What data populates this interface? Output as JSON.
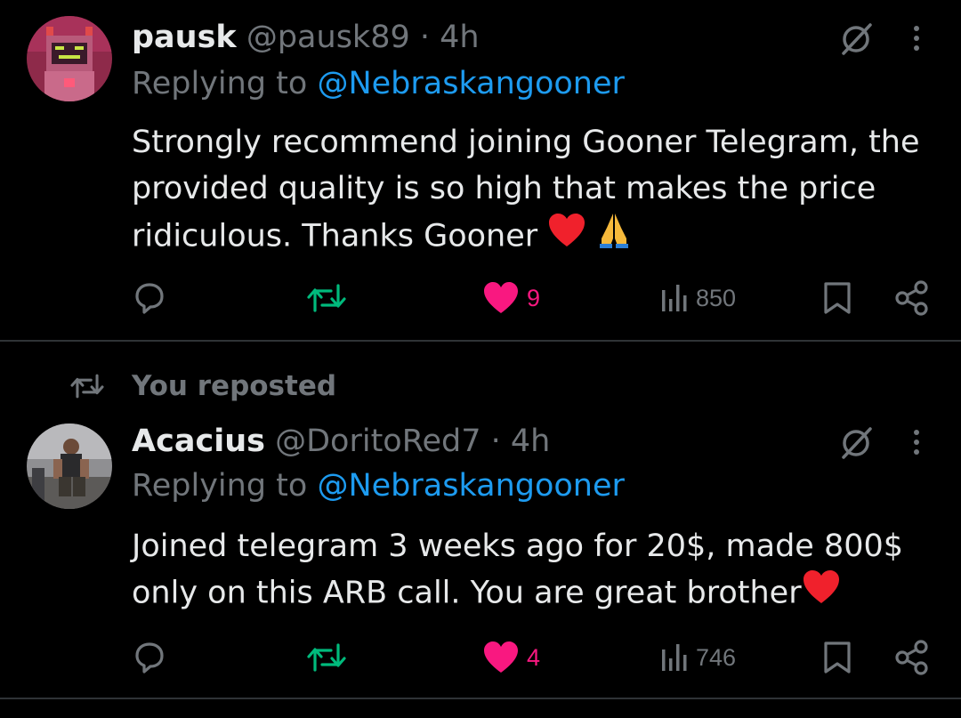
{
  "tweets": [
    {
      "display_name": "pausk",
      "handle": "@pausk89",
      "separator": "·",
      "time": "4h",
      "replying_prefix": "Replying to",
      "replying_to": "@Nebraskangooner",
      "text": "Strongly recommend joining Gooner Telegram, the provided quality is so high that makes the price ridiculous. Thanks Gooner",
      "emojis": [
        "red-heart",
        "folded-hands"
      ],
      "likes": "9",
      "views": "850",
      "liked": true
    },
    {
      "repost_label": "You reposted",
      "display_name": "Acacius",
      "handle": "@DoritoRed7",
      "separator": "·",
      "time": "4h",
      "replying_prefix": "Replying to",
      "replying_to": "@Nebraskangooner",
      "text": "Joined telegram 3 weeks ago for 20$, made 800$ only on this ARB call. You are great brother",
      "emojis": [
        "red-heart"
      ],
      "likes": "4",
      "views": "746",
      "liked": true
    }
  ],
  "colors": {
    "background": "#000000",
    "text": "#e7e9ea",
    "muted": "#71767b",
    "mention": "#1d9bf0",
    "repost": "#00ba7c",
    "like": "#f91880",
    "divider": "#2f3336"
  },
  "icons": {
    "reply": "reply-bubble-icon",
    "repost": "repost-arrows-icon",
    "like": "heart-icon",
    "views": "analytics-bars-icon",
    "bookmark": "bookmark-icon",
    "share": "share-icon",
    "grok": "grok-slash-icon",
    "more": "more-vertical-icon"
  }
}
